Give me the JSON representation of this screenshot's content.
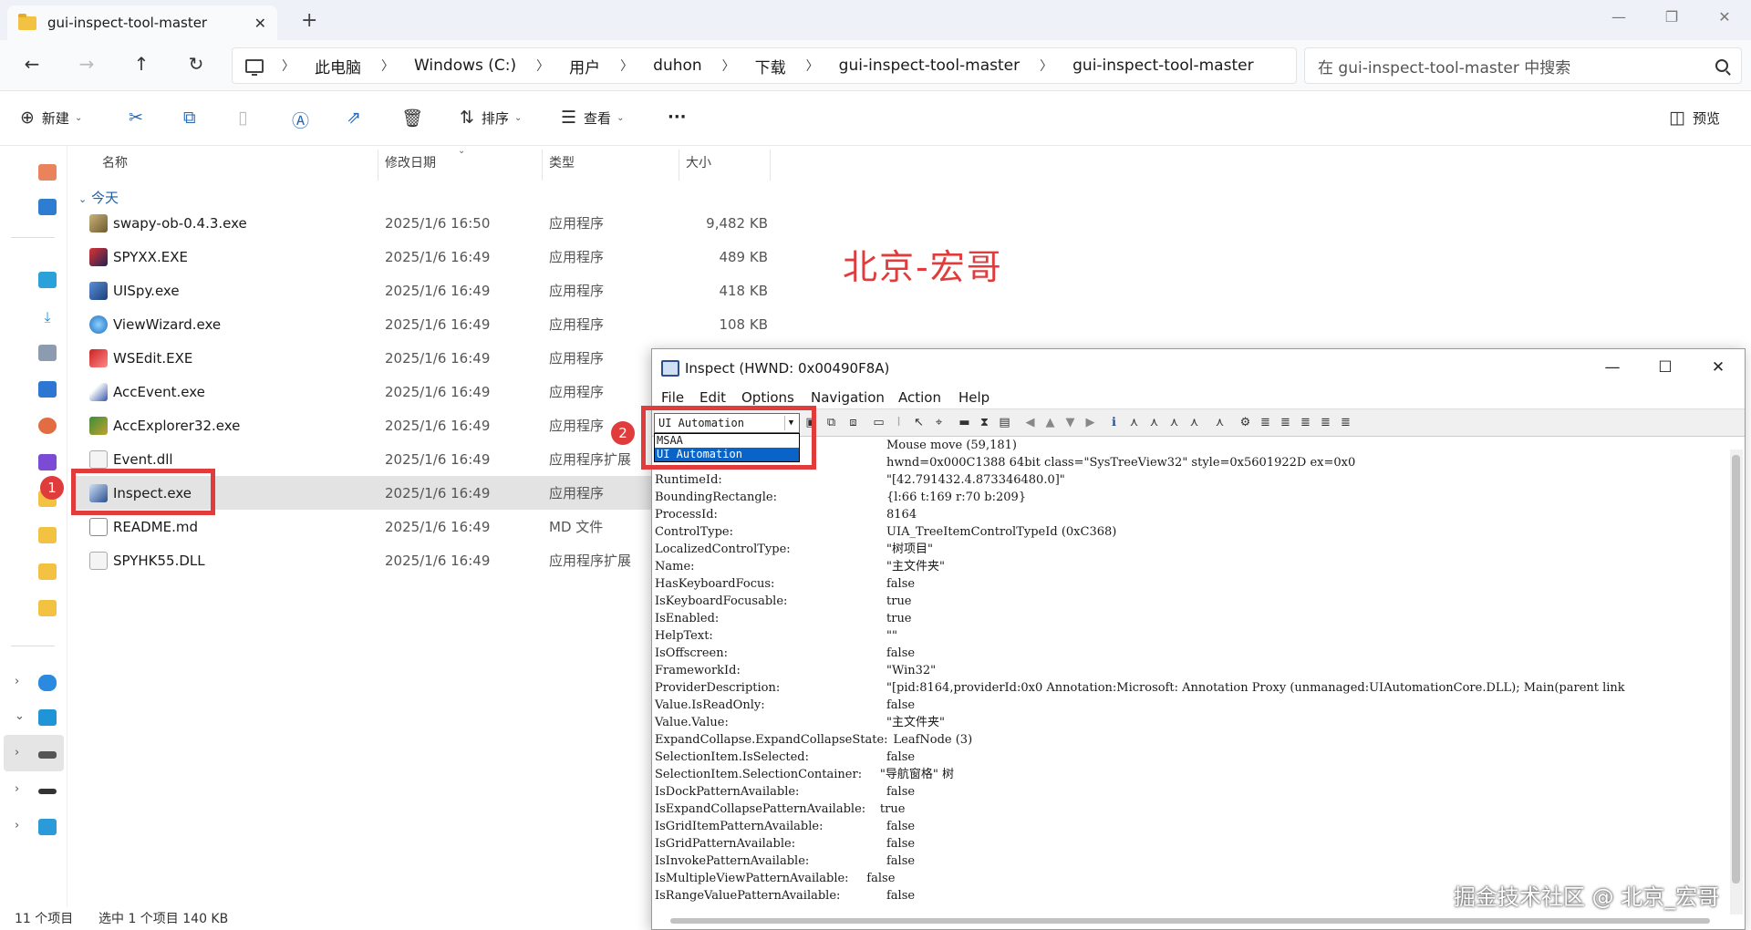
{
  "explorer": {
    "tab_title": "gui-inspect-tool-master",
    "tab_close": "✕",
    "new_tab": "+",
    "window_controls": {
      "minimize": "—",
      "restore": "❐",
      "close": "✕"
    },
    "nav": {
      "back": "←",
      "forward": "→",
      "up": "↑",
      "refresh": "↻"
    },
    "breadcrumb": [
      "此电脑",
      "Windows (C:)",
      "用户",
      "duhon",
      "下载",
      "gui-inspect-tool-master",
      "gui-inspect-tool-master"
    ],
    "search_placeholder": "在 gui-inspect-tool-master 中搜索",
    "toolbar": {
      "new_label": "新建",
      "sort_label": "排序",
      "view_label": "查看",
      "more_label": "···",
      "preview_label": "预览"
    },
    "columns": {
      "name": "名称",
      "date": "修改日期",
      "type": "类型",
      "size": "大小"
    },
    "group_label": "今天",
    "files": [
      {
        "name": "swapy-ob-0.4.3.exe",
        "date": "2025/1/6 16:50",
        "type": "应用程序",
        "size": "9,482 KB"
      },
      {
        "name": "SPYXX.EXE",
        "date": "2025/1/6 16:49",
        "type": "应用程序",
        "size": "489 KB"
      },
      {
        "name": "UISpy.exe",
        "date": "2025/1/6 16:49",
        "type": "应用程序",
        "size": "418 KB"
      },
      {
        "name": "ViewWizard.exe",
        "date": "2025/1/6 16:49",
        "type": "应用程序",
        "size": "108 KB"
      },
      {
        "name": "WSEdit.EXE",
        "date": "2025/1/6 16:49",
        "type": "应用程序",
        "size": ""
      },
      {
        "name": "AccEvent.exe",
        "date": "2025/1/6 16:49",
        "type": "应用程序",
        "size": ""
      },
      {
        "name": "AccExplorer32.exe",
        "date": "2025/1/6 16:49",
        "type": "应用程序",
        "size": ""
      },
      {
        "name": "Event.dll",
        "date": "2025/1/6 16:49",
        "type": "应用程序扩展",
        "size": ""
      },
      {
        "name": "Inspect.exe",
        "date": "2025/1/6 16:49",
        "type": "应用程序",
        "size": ""
      },
      {
        "name": "README.md",
        "date": "2025/1/6 16:49",
        "type": "MD 文件",
        "size": ""
      },
      {
        "name": "SPYHK55.DLL",
        "date": "2025/1/6 16:49",
        "type": "应用程序扩展",
        "size": ""
      }
    ],
    "watermark": "北京-宏哥",
    "badge1": "1",
    "status": {
      "count": "11 个项目",
      "selection": "选中 1 个项目  140 KB"
    }
  },
  "inspect": {
    "title": "Inspect  (HWND: 0x00490F8A)",
    "window_controls": {
      "minimize": "—",
      "maximize": "☐",
      "close": "✕"
    },
    "menu": [
      "File",
      "Edit",
      "Options",
      "Navigation",
      "Action",
      "Help"
    ],
    "mode_selected": "UI Automation",
    "mode_options": [
      "MSAA",
      "UI Automation"
    ],
    "badge2": "2",
    "properties": [
      [
        "",
        "Mouse move (59,181)"
      ],
      [
        "",
        "hwnd=0x000C1388 64bit class=\"SysTreeView32\" style=0x5601922D ex=0x0"
      ],
      [
        "RuntimeId:",
        "\"[42.791432.4.873346480.0]\""
      ],
      [
        "BoundingRectangle:",
        "{l:66 t:169 r:70 b:209}"
      ],
      [
        "ProcessId:",
        "8164"
      ],
      [
        "ControlType:",
        "UIA_TreeItemControlTypeId (0xC368)"
      ],
      [
        "LocalizedControlType:",
        "\"树项目\""
      ],
      [
        "Name:",
        "\"主文件夹\""
      ],
      [
        "HasKeyboardFocus:",
        "false"
      ],
      [
        "IsKeyboardFocusable:",
        "true"
      ],
      [
        "IsEnabled:",
        "true"
      ],
      [
        "HelpText:",
        "\"\""
      ],
      [
        "IsOffscreen:",
        "false"
      ],
      [
        "FrameworkId:",
        "\"Win32\""
      ],
      [
        "ProviderDescription:",
        "\"[pid:8164,providerId:0x0 Annotation:Microsoft: Annotation Proxy (unmanaged:UIAutomationCore.DLL); Main(parent link"
      ],
      [
        "Value.IsReadOnly:",
        "false"
      ],
      [
        "Value.Value:",
        "\"主文件夹\""
      ],
      [
        "ExpandCollapse.ExpandCollapseState:",
        "LeafNode (3)"
      ],
      [
        "SelectionItem.IsSelected:",
        "false"
      ],
      [
        "SelectionItem.SelectionContainer:",
        "\"导航窗格\" 树"
      ],
      [
        "IsDockPatternAvailable:",
        "false"
      ],
      [
        "IsExpandCollapsePatternAvailable:",
        "true"
      ],
      [
        "IsGridItemPatternAvailable:",
        "false"
      ],
      [
        "IsGridPatternAvailable:",
        "false"
      ],
      [
        "IsInvokePatternAvailable:",
        "false"
      ],
      [
        "IsMultipleViewPatternAvailable:",
        "false"
      ],
      [
        "IsRangeValuePatternAvailable:",
        "false"
      ]
    ]
  },
  "footer_watermark": "掘金技术社区 @ 北京_宏哥",
  "colors": {
    "accent_red": "#e03c3c",
    "selection_blue": "#0a64c8",
    "link_blue": "#1a5fb4"
  }
}
